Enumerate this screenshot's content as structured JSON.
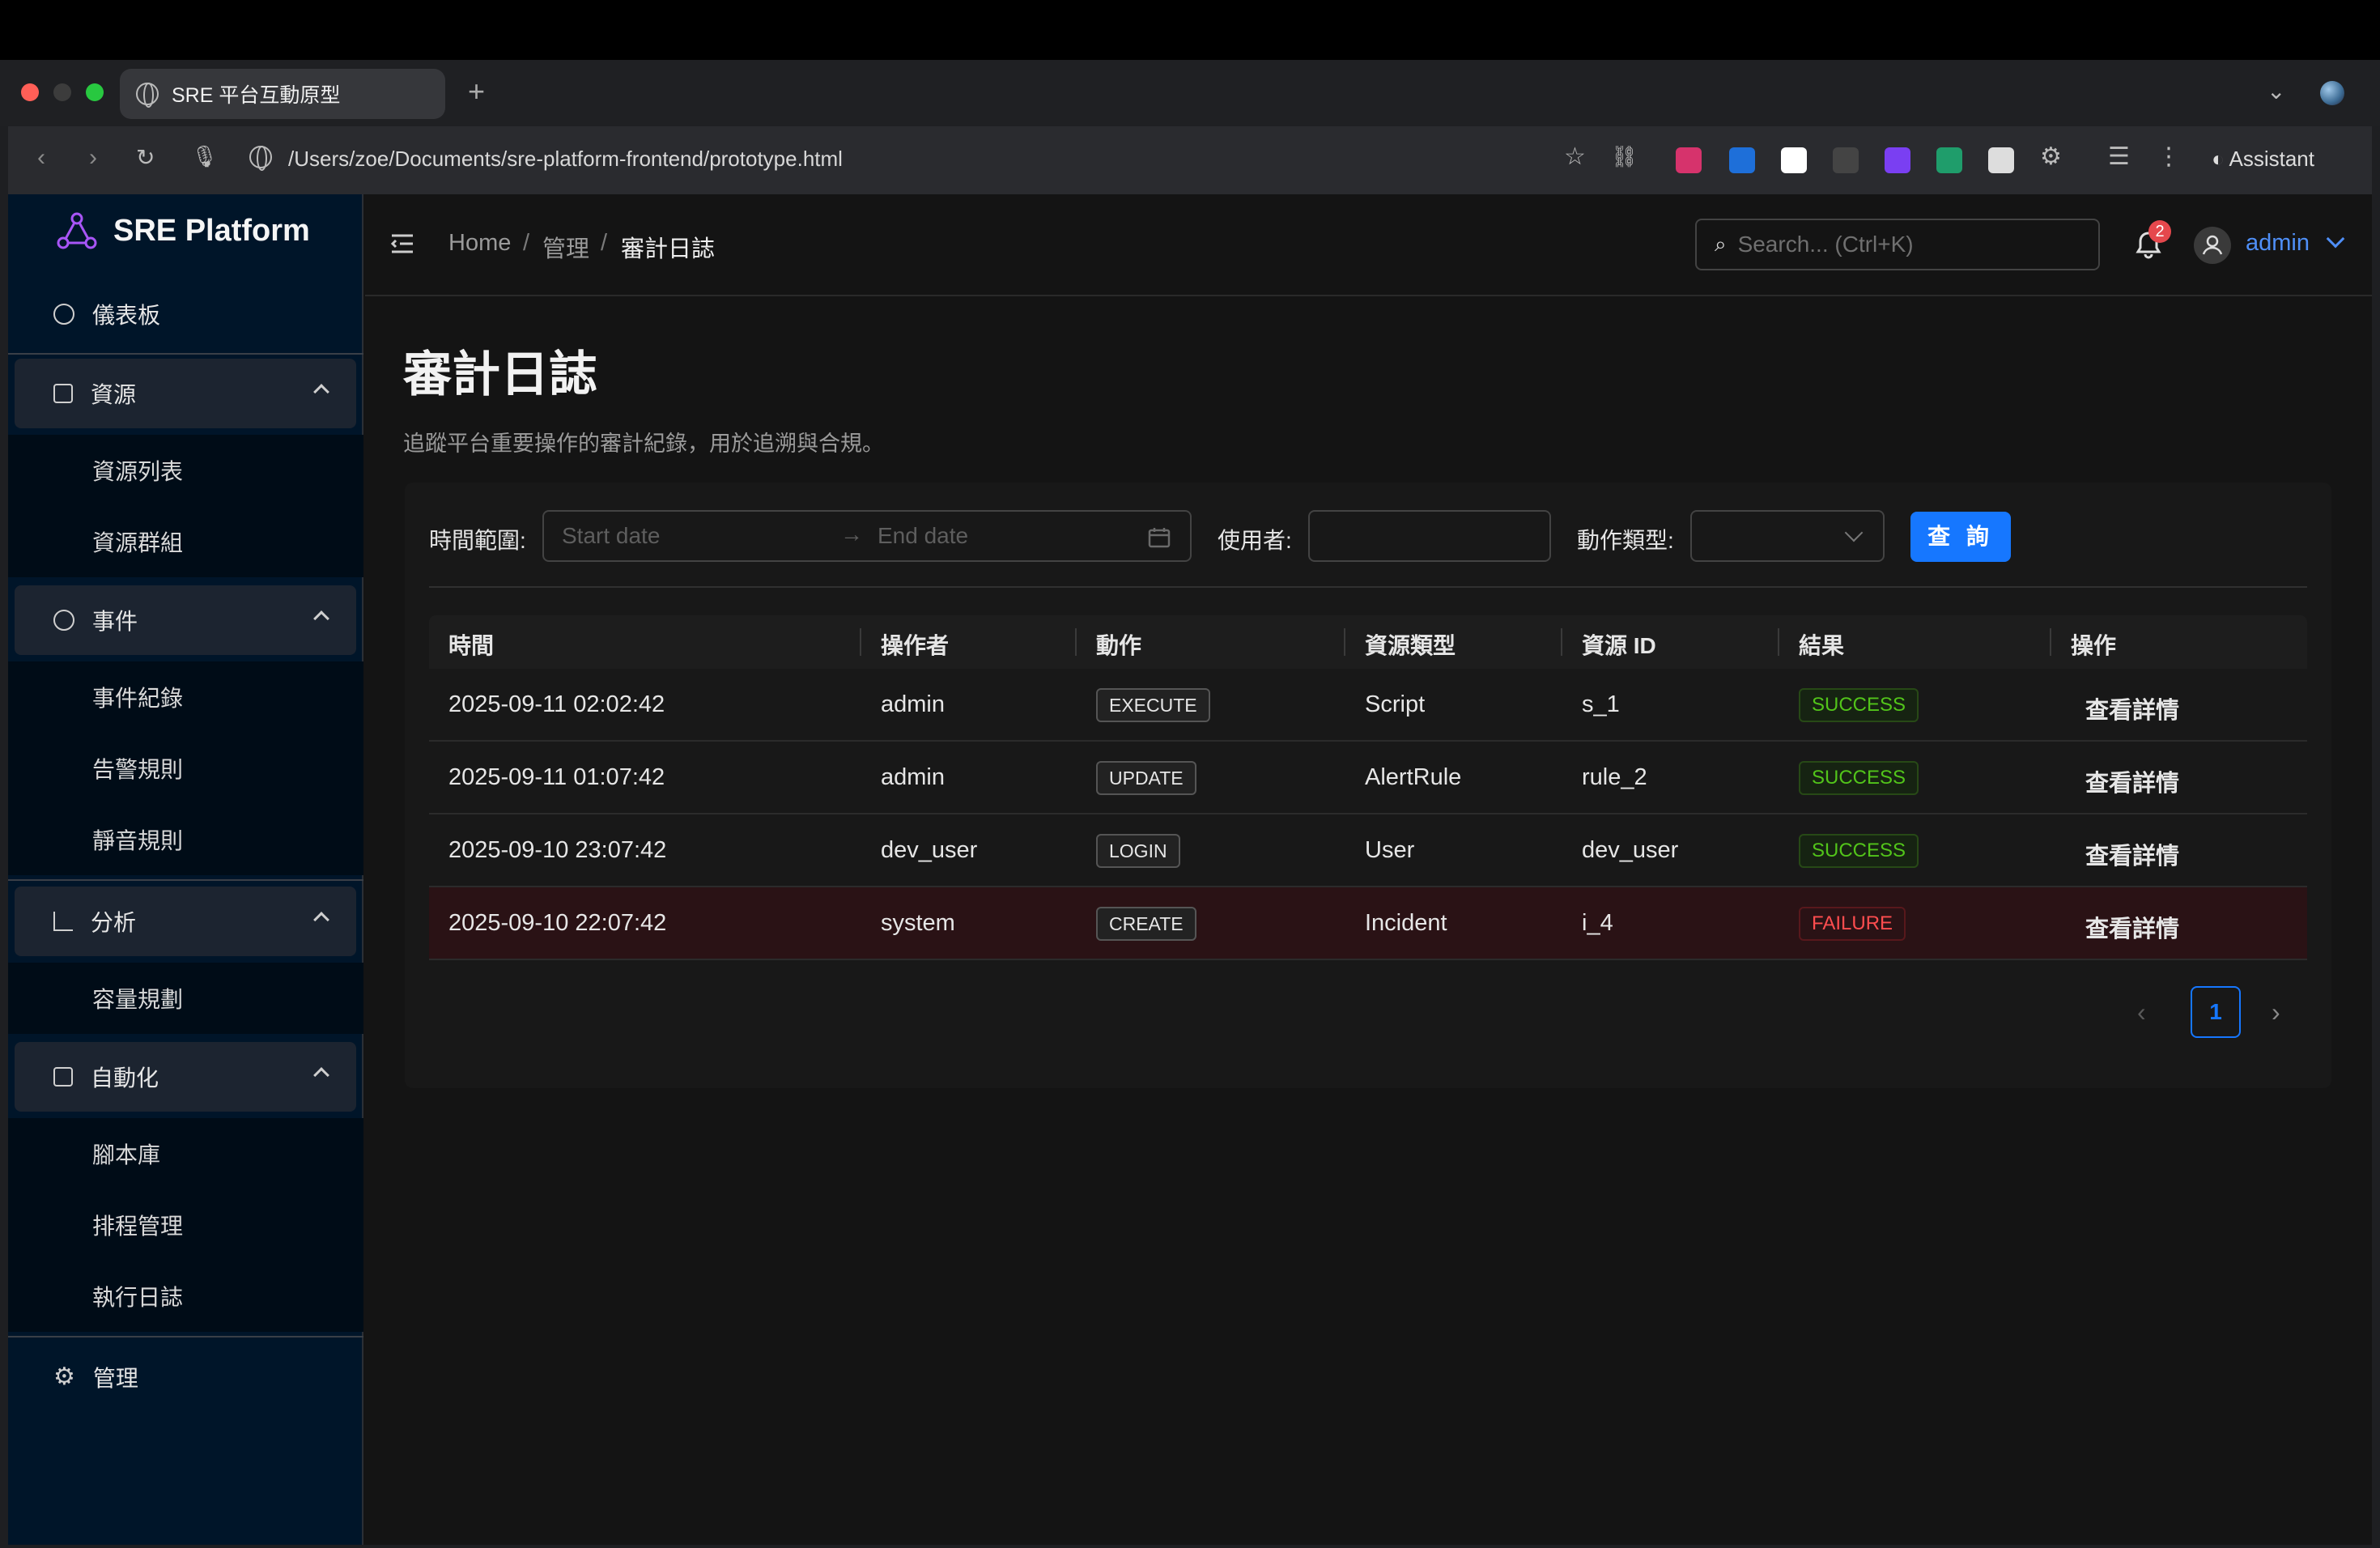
{
  "browser": {
    "tab_title": "SRE 平台互動原型",
    "url": "/Users/zoe/Documents/sre-platform-frontend/prototype.html",
    "assistant_label": "Assistant"
  },
  "sidebar": {
    "brand": "SRE Platform",
    "dashboard": "儀表板",
    "groups": [
      {
        "label": "資源",
        "items": [
          "資源列表",
          "資源群組"
        ]
      },
      {
        "label": "事件",
        "items": [
          "事件紀錄",
          "告警規則",
          "靜音規則"
        ]
      },
      {
        "label": "分析",
        "items": [
          "容量規劃"
        ]
      },
      {
        "label": "自動化",
        "items": [
          "腳本庫",
          "排程管理",
          "執行日誌"
        ]
      }
    ],
    "admin": "管理"
  },
  "header": {
    "breadcrumb": [
      "Home",
      "管理",
      "審計日誌"
    ],
    "search_placeholder": "Search... (Ctrl+K)",
    "notification_count": "2",
    "user": "admin"
  },
  "page": {
    "title": "審計日誌",
    "description": "追蹤平台重要操作的審計紀錄，用於追溯與合規。"
  },
  "filters": {
    "time_range_label": "時間範圍:",
    "start_placeholder": "Start date",
    "end_placeholder": "End date",
    "user_label": "使用者:",
    "action_type_label": "動作類型:",
    "query_button": "查 詢"
  },
  "table": {
    "headers": [
      "時間",
      "操作者",
      "動作",
      "資源類型",
      "資源 ID",
      "結果",
      "操作"
    ],
    "rows": [
      {
        "time": "2025-09-11 02:02:42",
        "operator": "admin",
        "action": "EXECUTE",
        "resource_type": "Script",
        "resource_id": "s_1",
        "result": "SUCCESS",
        "op": "查看詳情"
      },
      {
        "time": "2025-09-11 01:07:42",
        "operator": "admin",
        "action": "UPDATE",
        "resource_type": "AlertRule",
        "resource_id": "rule_2",
        "result": "SUCCESS",
        "op": "查看詳情"
      },
      {
        "time": "2025-09-10 23:07:42",
        "operator": "dev_user",
        "action": "LOGIN",
        "resource_type": "User",
        "resource_id": "dev_user",
        "result": "SUCCESS",
        "op": "查看詳情"
      },
      {
        "time": "2025-09-10 22:07:42",
        "operator": "system",
        "action": "CREATE",
        "resource_type": "Incident",
        "resource_id": "i_4",
        "result": "FAILURE",
        "op": "查看詳情"
      }
    ]
  },
  "pagination": {
    "current": "1"
  },
  "colors": {
    "accent": "#1677ff",
    "success": "#52c41a",
    "failure": "#ff4d4f",
    "sidebar_bg": "#001529"
  }
}
